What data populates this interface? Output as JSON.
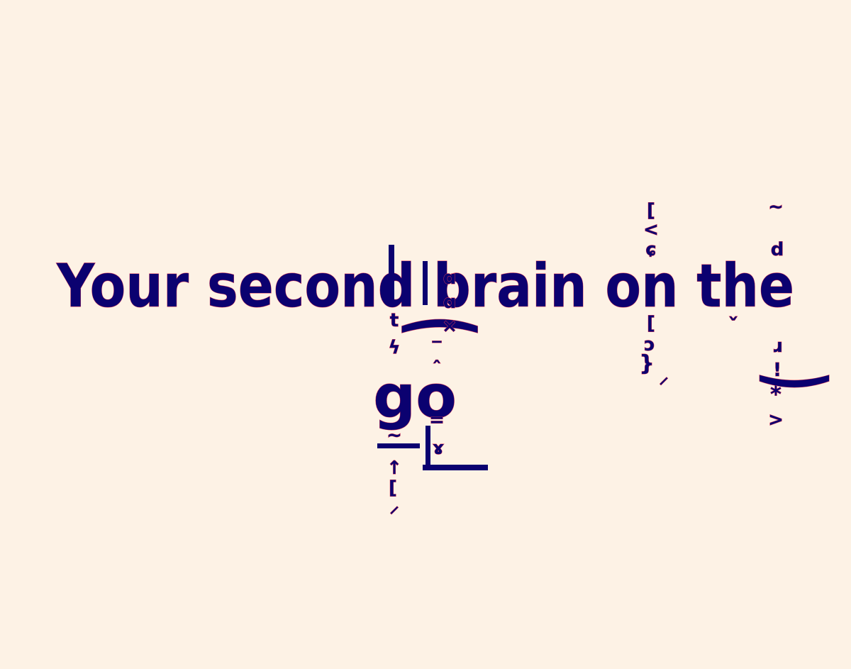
{
  "headline": {
    "line1": "Your second brain on the",
    "line2": "go"
  },
  "glitch_glyphs": [
    "⁔",
    "⁀",
    "ˇ",
    "ˆ",
    "ˇ",
    "~",
    "ˆ",
    "ˇ",
    "‿",
    "t",
    "ϟ",
    "~",
    "‾",
    "↑",
    "[",
    "⸝",
    "~",
    "ɑ",
    "×",
    "ɑ",
    "=",
    "ɤ",
    "[",
    "<",
    "ɕ",
    "%",
    "[",
    "ɔ",
    "}",
    "⸝",
    "~",
    "d",
    "ɹ",
    "!",
    "*",
    ">"
  ],
  "colors": {
    "background": "#fdf2e5",
    "text": "#0b0170",
    "shadow": "#e23b53"
  }
}
